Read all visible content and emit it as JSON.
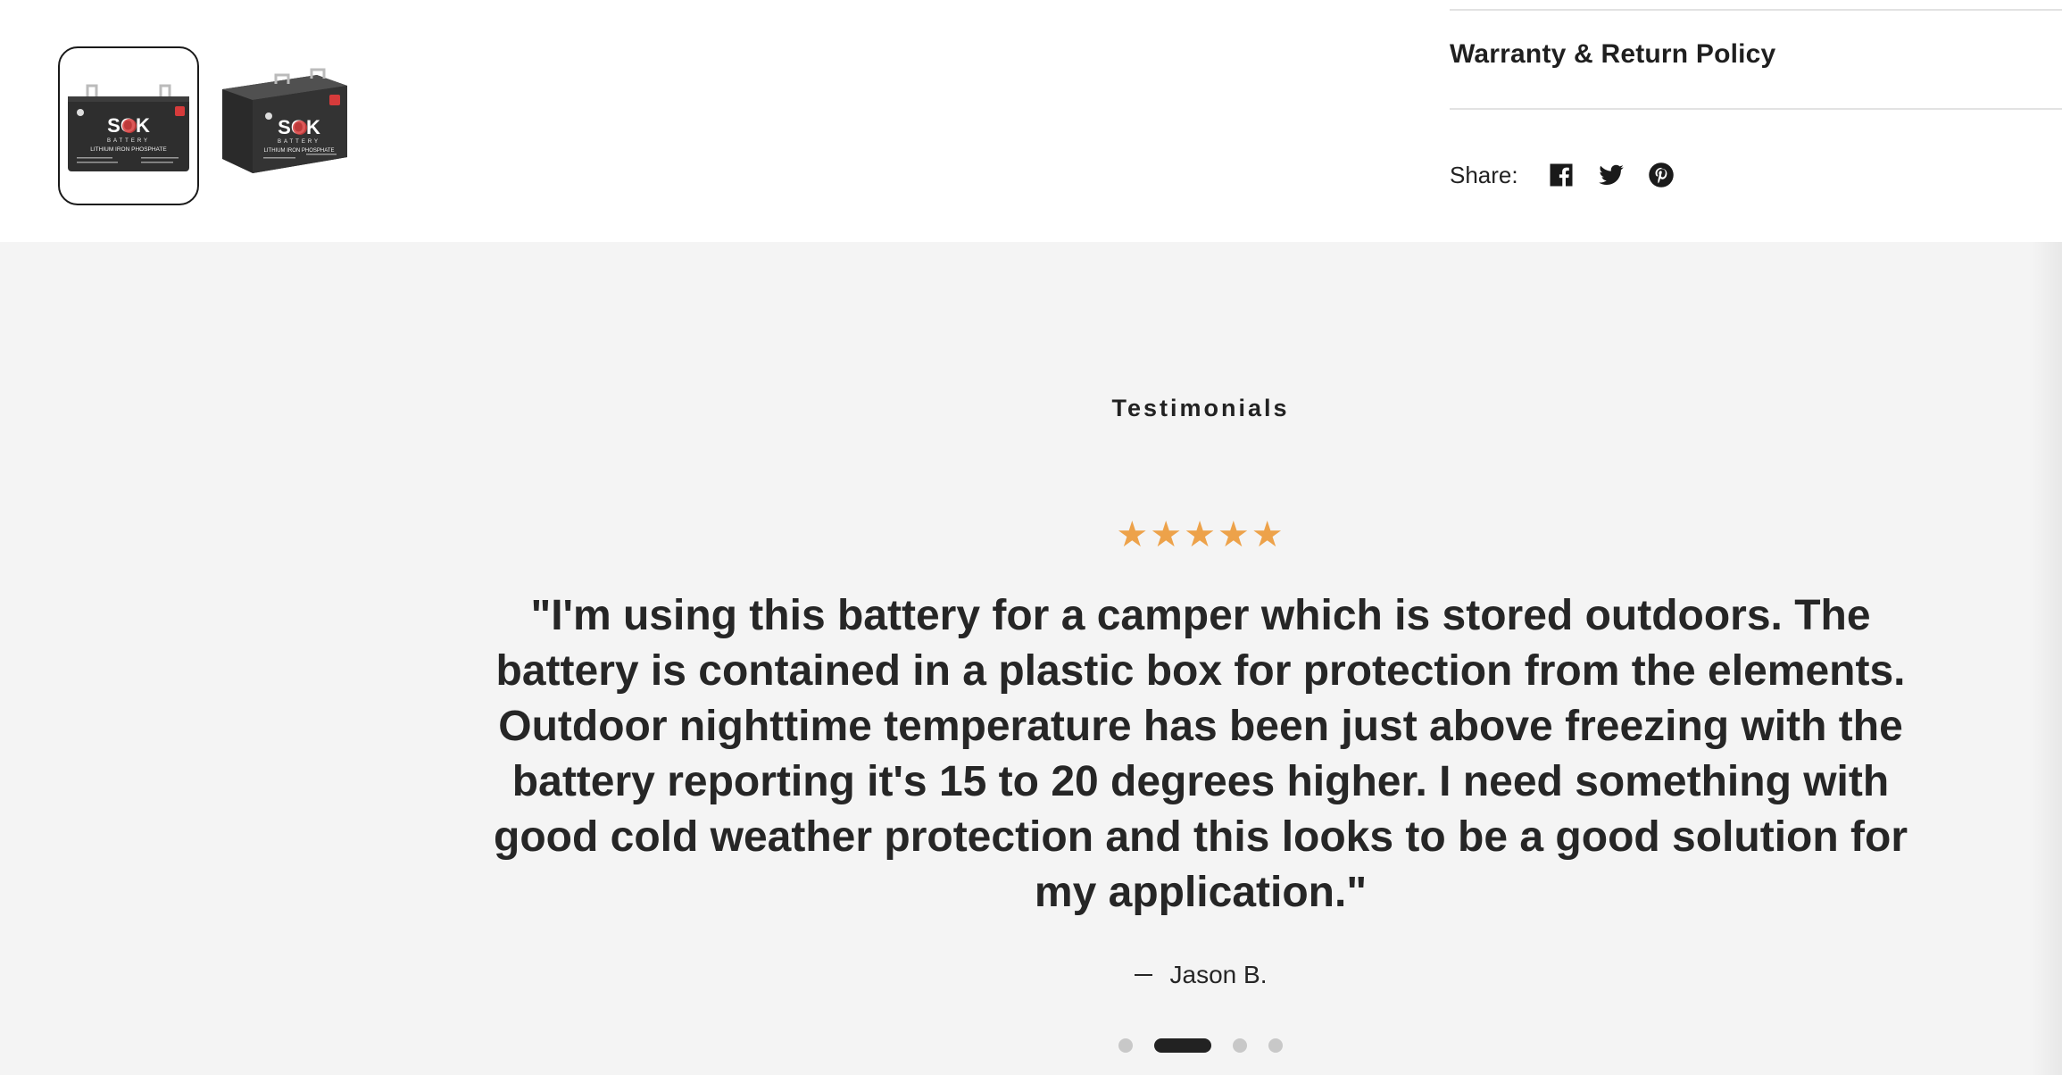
{
  "gallery": {
    "thumbnails": [
      {
        "alt": "SOK battery front view",
        "brand": "SOK",
        "subtitle": "BATTERY",
        "line": "LITHIUM IRON PHOSPHATE",
        "active": true
      },
      {
        "alt": "SOK battery angled view",
        "brand": "SOK",
        "subtitle": "BATTERY",
        "line": "LITHIUM IRON PHOSPHATE",
        "active": false
      }
    ]
  },
  "product_info": {
    "policy_label": "Warranty & Return Policy",
    "share_label": "Share:",
    "share_icons": [
      "facebook-icon",
      "twitter-icon",
      "pinterest-icon"
    ]
  },
  "testimonials": {
    "title": "Testimonials",
    "rating": "★★★★★",
    "rating_value": 5,
    "star_color": "#eda24a",
    "quote": "\"I'm using this battery for a camper which is stored outdoors. The battery is contained in a plastic box for protection from the elements. Outdoor nighttime temperature has been just above freezing with the battery reporting it's 15 to 20 degrees higher. I need something with good cold weather protection and this looks to be a good solution for my application.\"",
    "author": "Jason B.",
    "slide_count": 4,
    "active_slide": 2
  },
  "colors": {
    "section_background": "#f4f4f4",
    "text": "#262626"
  }
}
